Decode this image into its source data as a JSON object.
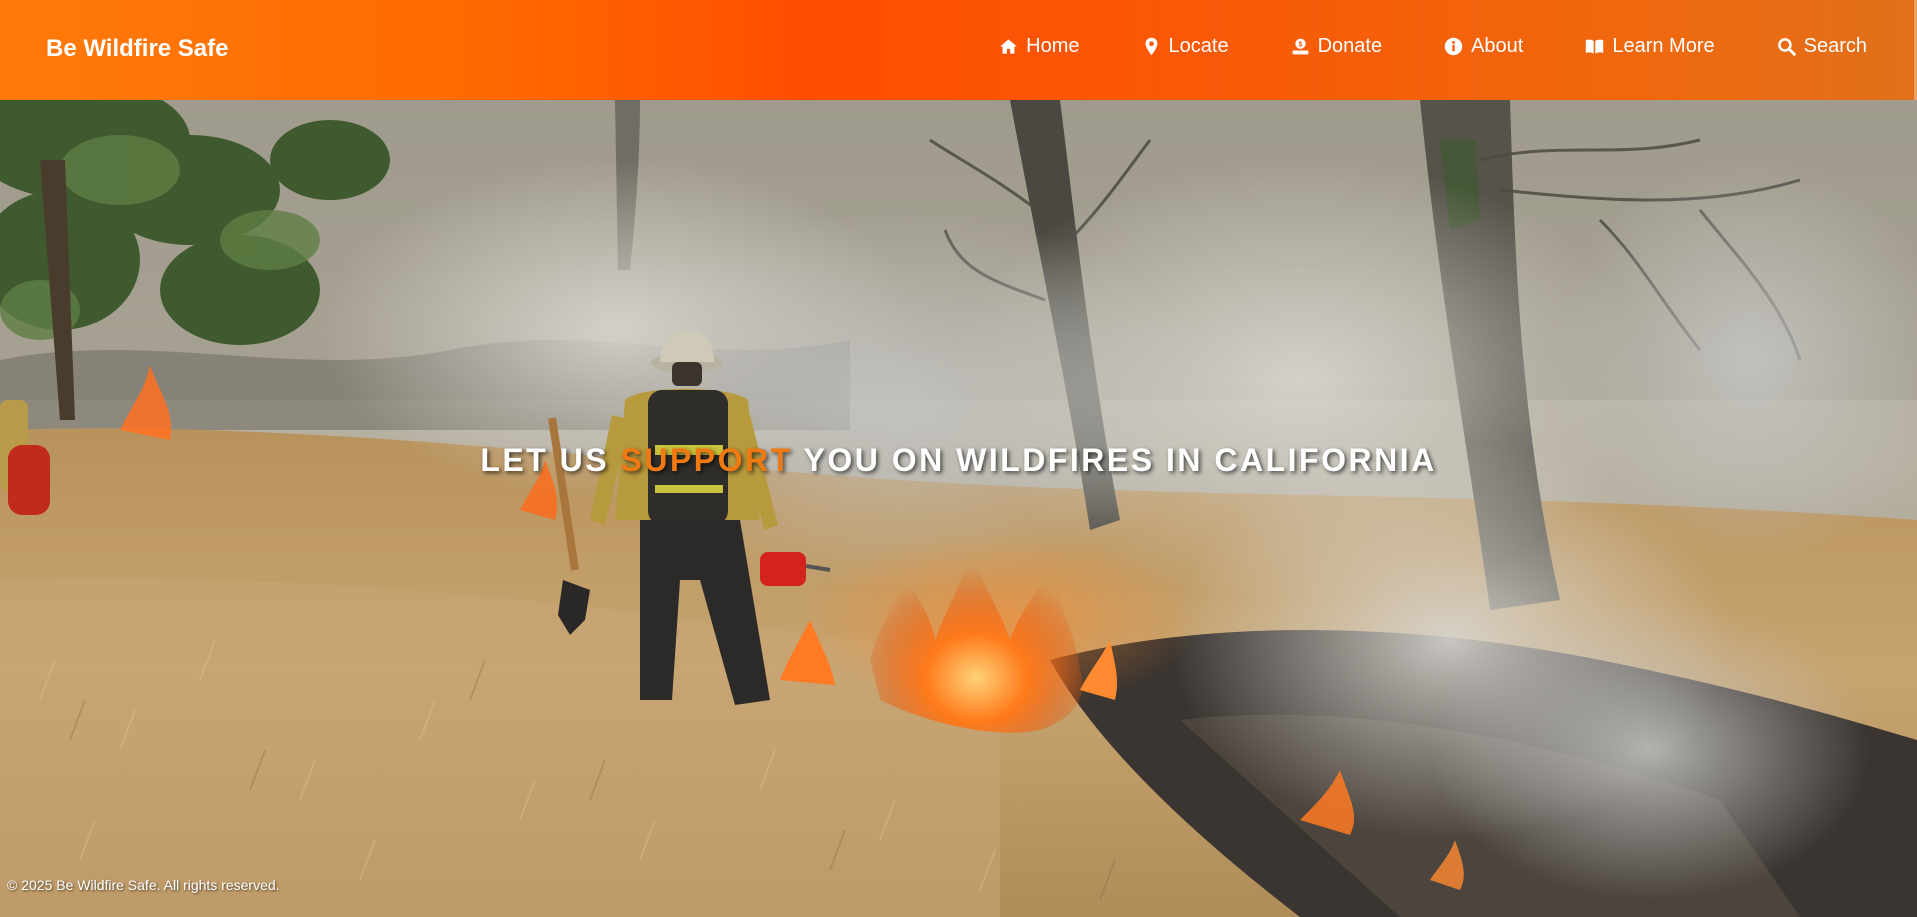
{
  "brand": {
    "name": "Be Wildfire Safe"
  },
  "nav": {
    "items": [
      {
        "label": "Home",
        "icon": "home-icon"
      },
      {
        "label": "Locate",
        "icon": "map-pin-icon"
      },
      {
        "label": "Donate",
        "icon": "donate-icon"
      },
      {
        "label": "About",
        "icon": "info-icon"
      },
      {
        "label": "Learn More",
        "icon": "book-icon"
      },
      {
        "label": "Search",
        "icon": "search-icon"
      }
    ]
  },
  "hero": {
    "headline_before": "LET US ",
    "headline_accent": "SUPPORT",
    "headline_after": " YOU ON WILDFIRES IN CALIFORNIA",
    "background": "firefighter-walking-through-grass-fire-image"
  },
  "footer": {
    "copyright": "© 2025 Be Wildfire Safe. All rights reserved."
  },
  "colors": {
    "header_start": "#ff7a0a",
    "header_mid": "#ff4d00",
    "header_end": "#e0701a",
    "accent": "#f07a12",
    "text": "#ffffff"
  }
}
